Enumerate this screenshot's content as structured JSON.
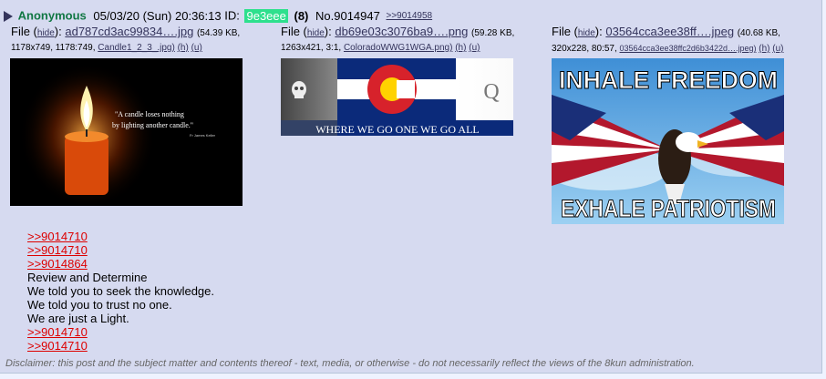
{
  "post": {
    "name": "Anonymous",
    "date": "05/03/20 (Sun) 20:36:13",
    "id_label": "ID:",
    "poster_id": "9e3eee",
    "post_count": "(8)",
    "number": "No.9014947",
    "backlink": ">>9014958"
  },
  "files": [
    {
      "prefix": "File (",
      "hide": "hide",
      "mid": "): ",
      "filename": "ad787cd3ac99834….jpg",
      "size": "(54.39 KB,",
      "meta_dims": "1178x749, 1178:749,",
      "orig_name": "Candle1_2_3_.jpg)",
      "h": "(h)",
      "u": "(u)",
      "caption": "\"A candle loses nothing by lighting another candle.\"",
      "credit": "Fr James Keller"
    },
    {
      "prefix": "File (",
      "hide": "hide",
      "mid": "): ",
      "filename": "db69e03c3076ba9….png",
      "size": "(59.28 KB,",
      "meta_dims": "1263x421, 3:1,",
      "orig_name": "ColoradoWWG1WGA.png)",
      "h": "(h)",
      "u": "(u)",
      "banner": "WHERE WE GO ONE WE GO ALL",
      "q_letter": "Q"
    },
    {
      "prefix": "File (",
      "hide": "hide",
      "mid": "): ",
      "filename": "03564cca3ee38ff….jpeg",
      "size": "(40.68 KB,",
      "meta_dims": "320x228, 80:57,",
      "orig_name": "03564cca3ee38ffc2d6b3422d….jpeg)",
      "h": "(h)",
      "u": "(u)",
      "top_text": "INHALE FREEDOM",
      "bottom_text": "EXHALE PATRIOTISM"
    }
  ],
  "body": {
    "quote1": ">>9014710",
    "quote2": ">>9014710",
    "quote3": ">>9014864",
    "line1": "Review and Determine",
    "line2": "We told you to seek the knowledge.",
    "line3": "We told you to trust no one.",
    "line4": "We are just a Light.",
    "quote4": ">>9014710",
    "quote5": ">>9014710"
  },
  "disclaimer": "Disclaimer: this post and the subject matter and contents thereof - text, media, or otherwise - do not necessarily reflect the views of the 8kun administration."
}
